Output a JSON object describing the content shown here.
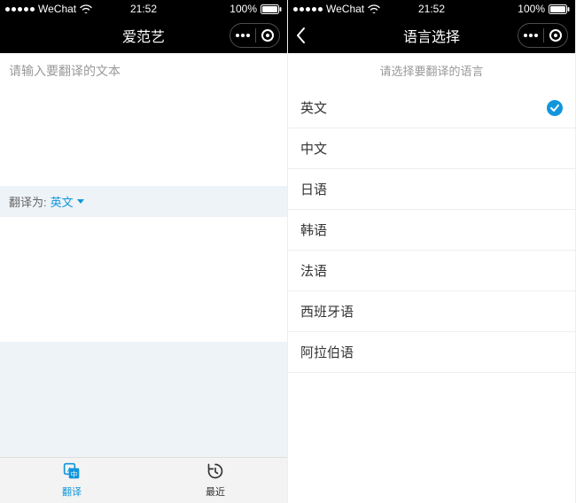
{
  "status": {
    "carrier": "WeChat",
    "time": "21:52",
    "battery": "100%"
  },
  "left": {
    "title": "爱范艺",
    "input_placeholder": "请输入要翻译的文本",
    "translate_label": "翻译为:",
    "translate_lang": "英文",
    "tabs": [
      {
        "label": "翻译",
        "active": true
      },
      {
        "label": "最近",
        "active": false
      }
    ]
  },
  "right": {
    "title": "语言选择",
    "hint": "请选择要翻译的语言",
    "languages": [
      {
        "name": "英文",
        "selected": true
      },
      {
        "name": "中文",
        "selected": false
      },
      {
        "name": "日语",
        "selected": false
      },
      {
        "name": "韩语",
        "selected": false
      },
      {
        "name": "法语",
        "selected": false
      },
      {
        "name": "西班牙语",
        "selected": false
      },
      {
        "name": "阿拉伯语",
        "selected": false
      }
    ]
  }
}
